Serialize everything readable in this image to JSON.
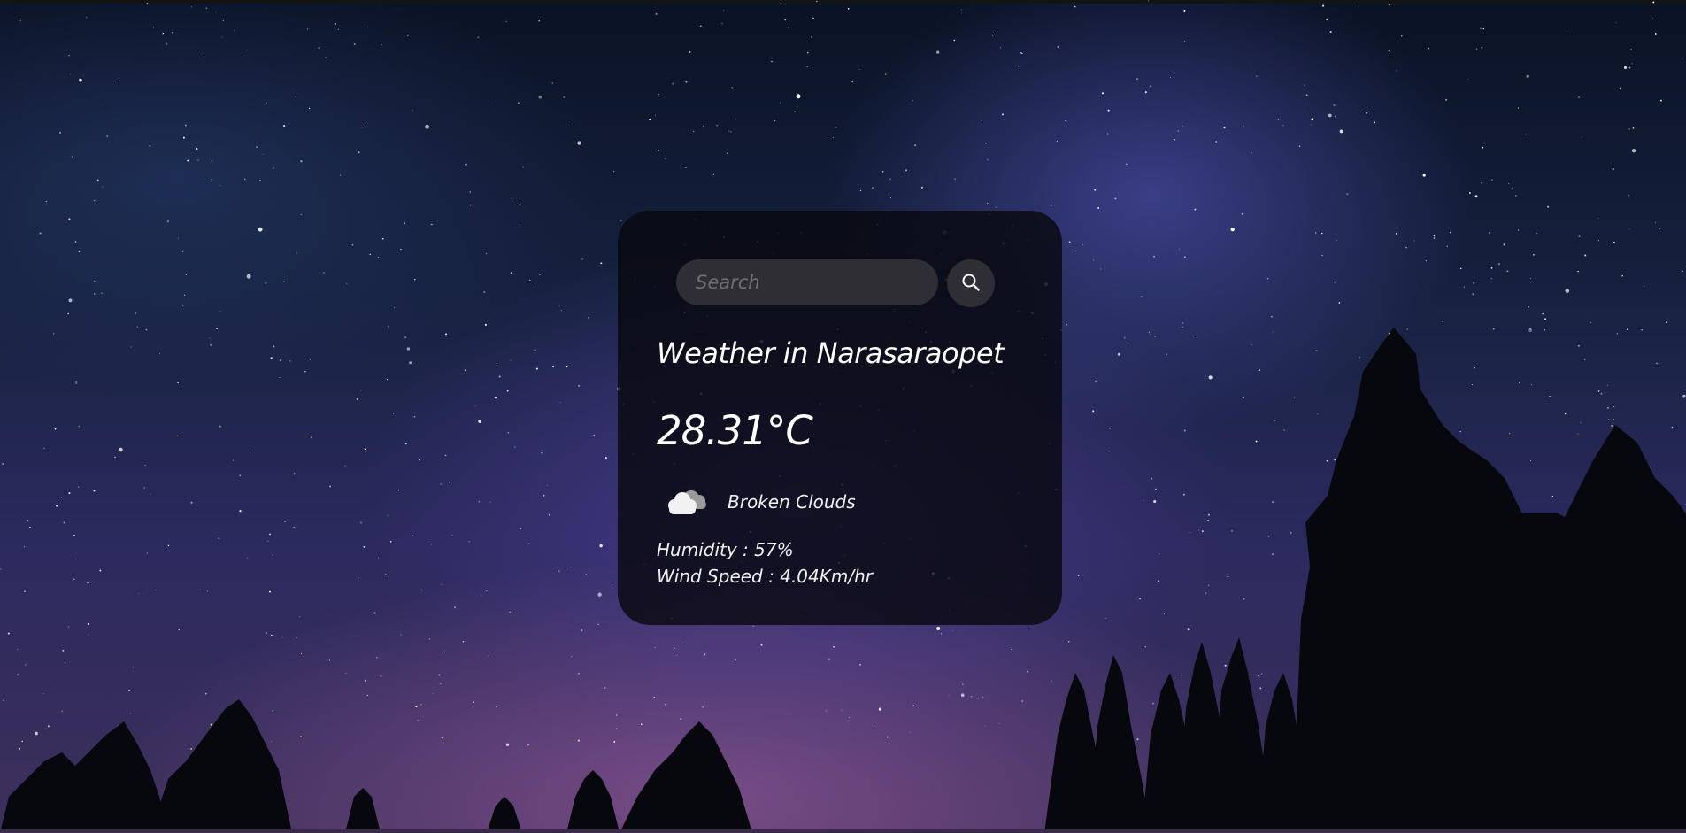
{
  "search": {
    "placeholder": "Search",
    "value": "",
    "icon": "search-icon"
  },
  "weather": {
    "city_title": "Weather in Narasaraopet",
    "temperature": "28.31°C",
    "condition_icon": "broken-clouds-icon",
    "condition": "Broken Clouds",
    "humidity": "Humidity : 57%",
    "wind_speed": "Wind Speed : 4.04Km/hr"
  },
  "colors": {
    "card_background": "#0a0a14",
    "input_background": "#302e35",
    "text": "#ffffff",
    "placeholder": "#6f6e74"
  }
}
